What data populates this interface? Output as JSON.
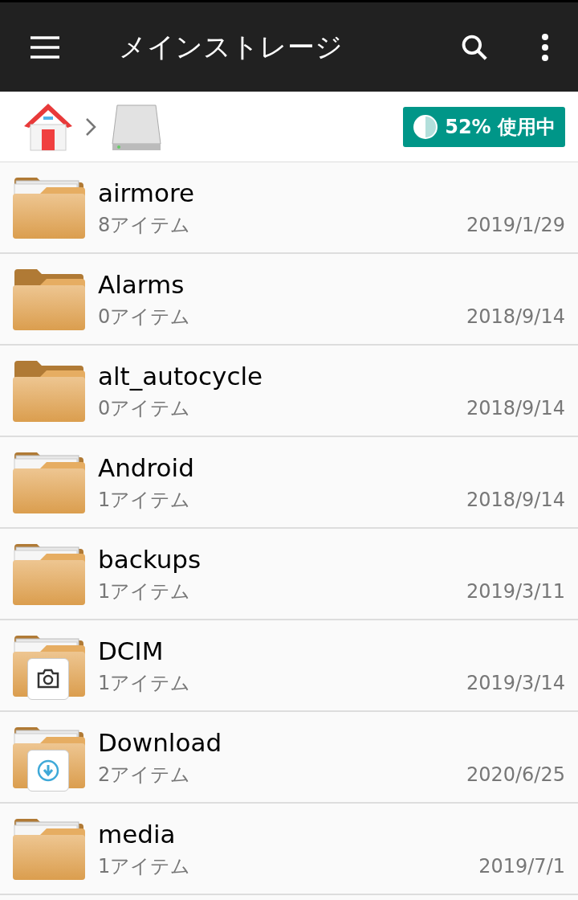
{
  "app_bar": {
    "title": "メインストレージ"
  },
  "breadcrumb": {
    "usage_badge": "52% 使用中"
  },
  "items": [
    {
      "name": "airmore",
      "count": "8アイテム",
      "date": "2019/1/29",
      "papers": true,
      "kind": "folder"
    },
    {
      "name": "Alarms",
      "count": "0アイテム",
      "date": "2018/9/14",
      "papers": false,
      "kind": "folder"
    },
    {
      "name": "alt_autocycle",
      "count": "0アイテム",
      "date": "2018/9/14",
      "papers": false,
      "kind": "folder"
    },
    {
      "name": "Android",
      "count": "1アイテム",
      "date": "2018/9/14",
      "papers": true,
      "kind": "folder"
    },
    {
      "name": "backups",
      "count": "1アイテム",
      "date": "2019/3/11",
      "papers": true,
      "kind": "folder"
    },
    {
      "name": "DCIM",
      "count": "1アイテム",
      "date": "2019/3/14",
      "papers": true,
      "kind": "camera"
    },
    {
      "name": "Download",
      "count": "2アイテム",
      "date": "2020/6/25",
      "papers": true,
      "kind": "download"
    },
    {
      "name": "media",
      "count": "1アイテム",
      "date": "2019/7/1",
      "papers": true,
      "kind": "folder"
    }
  ]
}
